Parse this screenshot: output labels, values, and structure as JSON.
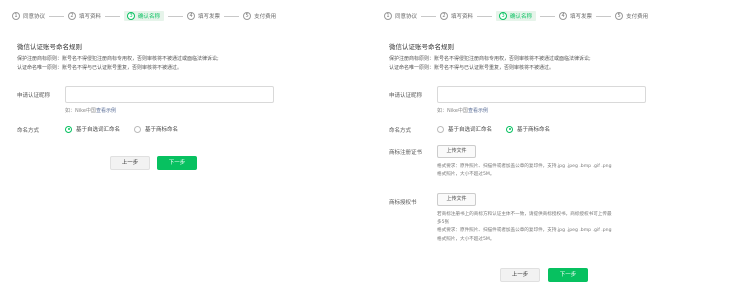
{
  "steps": [
    {
      "num": "1",
      "label": "同意协议"
    },
    {
      "num": "2",
      "label": "填写资料"
    },
    {
      "num": "3",
      "label": "确认名称"
    },
    {
      "num": "4",
      "label": "填写发票"
    },
    {
      "num": "5",
      "label": "支付费用"
    }
  ],
  "naming": {
    "section_title": "微信认证账号命名规则",
    "rule1": "保护注册商标原则：账号名不得侵犯注册商标专用权，否则审核将不被通过或面临法律诉讼;",
    "rule2": "认证命名唯一原则：账号名不得与已认证账号重复，否则审核将不被通过。",
    "apply_label": "申请认证昵称",
    "apply_hint_prefix": "如：Nike中国",
    "apply_hint_link": "查看示例",
    "method_label": "命名方式",
    "option_self": "基于自选词汇命名",
    "option_trademark": "基于商标命名"
  },
  "trademark": {
    "cert_label": "商标注册证书",
    "cert_upload": "上传文件",
    "cert_note1": "格式要求：原件照片、扫描件或者加盖公章的复印件，支持.jpg .jpeg .bmp .gif .png",
    "cert_note2": "格式照片，大小不超过5M。",
    "auth_label": "商标授权书",
    "auth_upload": "上传文件",
    "auth_note1": "若商标注册书上的商标方和认证主体不一致，请提供商标授权书，商标授权书可上传最",
    "auth_note2": "多5张",
    "auth_note3": "格式要求：原件照片、扫描件或者加盖公章的复印件，支持.jpg .jpeg .bmp .gif .png",
    "auth_note4": "格式照片，大小不超过5M。"
  },
  "buttons": {
    "prev": "上一步",
    "next": "下一步"
  },
  "colors": {
    "accent": "#07c160",
    "link": "#576b95",
    "active_step_bg": "#e6f4ea"
  }
}
